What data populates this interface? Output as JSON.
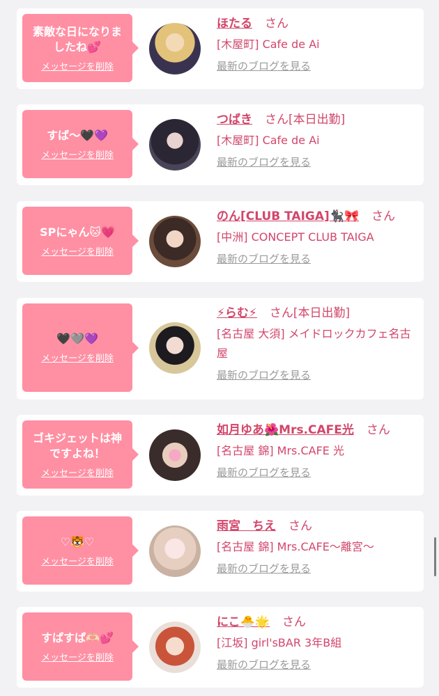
{
  "common": {
    "delete_label": "メッセージを削除",
    "blog_label": "最新のブログを見る",
    "san_label": "さん"
  },
  "colors": {
    "bubble": "#ff8fa3",
    "name": "#d2466a",
    "link_gray": "#9a9a9a",
    "background": "#f2f2f4"
  },
  "messages": [
    {
      "bubble_text": "素敵な日になりましたね💕",
      "name": "ほたる",
      "status": "",
      "shop": "[木屋町] Cafe de Ai",
      "avatar": "girl-blonde-photo"
    },
    {
      "bubble_text": "すば〜🖤💜",
      "name": "つばき",
      "status": "[本日出勤]",
      "shop": "[木屋町] Cafe de Ai",
      "avatar": "girl-dark-hair-photo"
    },
    {
      "bubble_text": "SPにゃん🐱💗",
      "name": "のん[CLUB TAIGA]🐈‍⬛🎀",
      "status": "",
      "shop": "[中洲] CONCEPT CLUB TAIGA",
      "avatar": "girl-cat-ears-photo"
    },
    {
      "bubble_text": "🖤🩶💜",
      "name": "⚡らむ⚡",
      "status": "[本日出勤]",
      "shop": "[名古屋 大須] メイドロックカフェ名古屋",
      "avatar": "girl-two-tone-hair-photo"
    },
    {
      "bubble_text": "ゴキジェットは神ですよね！",
      "name": "如月ゆあ🌺Mrs.CAFE光",
      "status": "",
      "shop": "[名古屋 錦] Mrs.CAFE 光",
      "avatar": "girl-heart-sticker-photo"
    },
    {
      "bubble_text": "♡🐯♡",
      "name": "雨宮　ちえ",
      "status": "",
      "shop": "[名古屋 錦] Mrs.CAFE〜離宮〜",
      "avatar": "girl-light-hair-photo"
    },
    {
      "bubble_text": "すぱすぱ🫶🏻💕",
      "name": "にこ🐣🌟",
      "status": "",
      "shop": "[江坂] girl'sBAR 3年B組",
      "avatar": "girl-red-hair-photo"
    }
  ]
}
